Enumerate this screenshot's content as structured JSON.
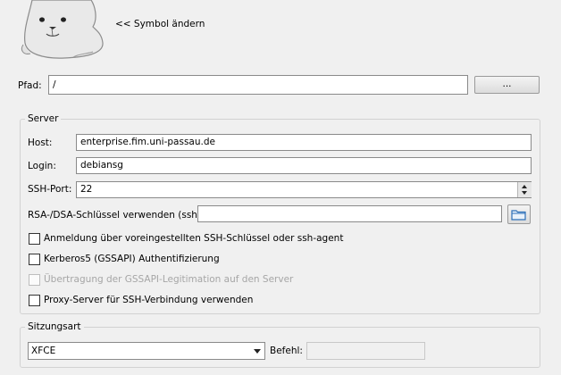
{
  "icon": {
    "change_label": "<< Symbol ändern"
  },
  "path": {
    "label": "Pfad:",
    "value": "/",
    "browse_label": "..."
  },
  "server": {
    "legend": "Server",
    "host_label": "Host:",
    "host_value": "enterprise.fim.uni-passau.de",
    "login_label": "Login:",
    "login_value": "debiansg",
    "port_label": "SSH-Port:",
    "port_value": "22",
    "key_label": "RSA-/DSA-Schlüssel verwenden (ssh):",
    "key_value": "",
    "checkboxes": [
      {
        "label": "Anmeldung über voreingestellten SSH-Schlüssel oder ssh-agent",
        "checked": false,
        "enabled": true
      },
      {
        "label": "Kerberos5 (GSSAPI) Authentifizierung",
        "checked": false,
        "enabled": true
      },
      {
        "label": "Übertragung der GSSAPI-Legitimation auf den Server",
        "checked": false,
        "enabled": false
      },
      {
        "label": "Proxy-Server für SSH-Verbindung verwenden",
        "checked": false,
        "enabled": true
      }
    ]
  },
  "session": {
    "legend": "Sitzungsart",
    "type_value": "XFCE",
    "command_label": "Befehl:",
    "command_value": ""
  }
}
